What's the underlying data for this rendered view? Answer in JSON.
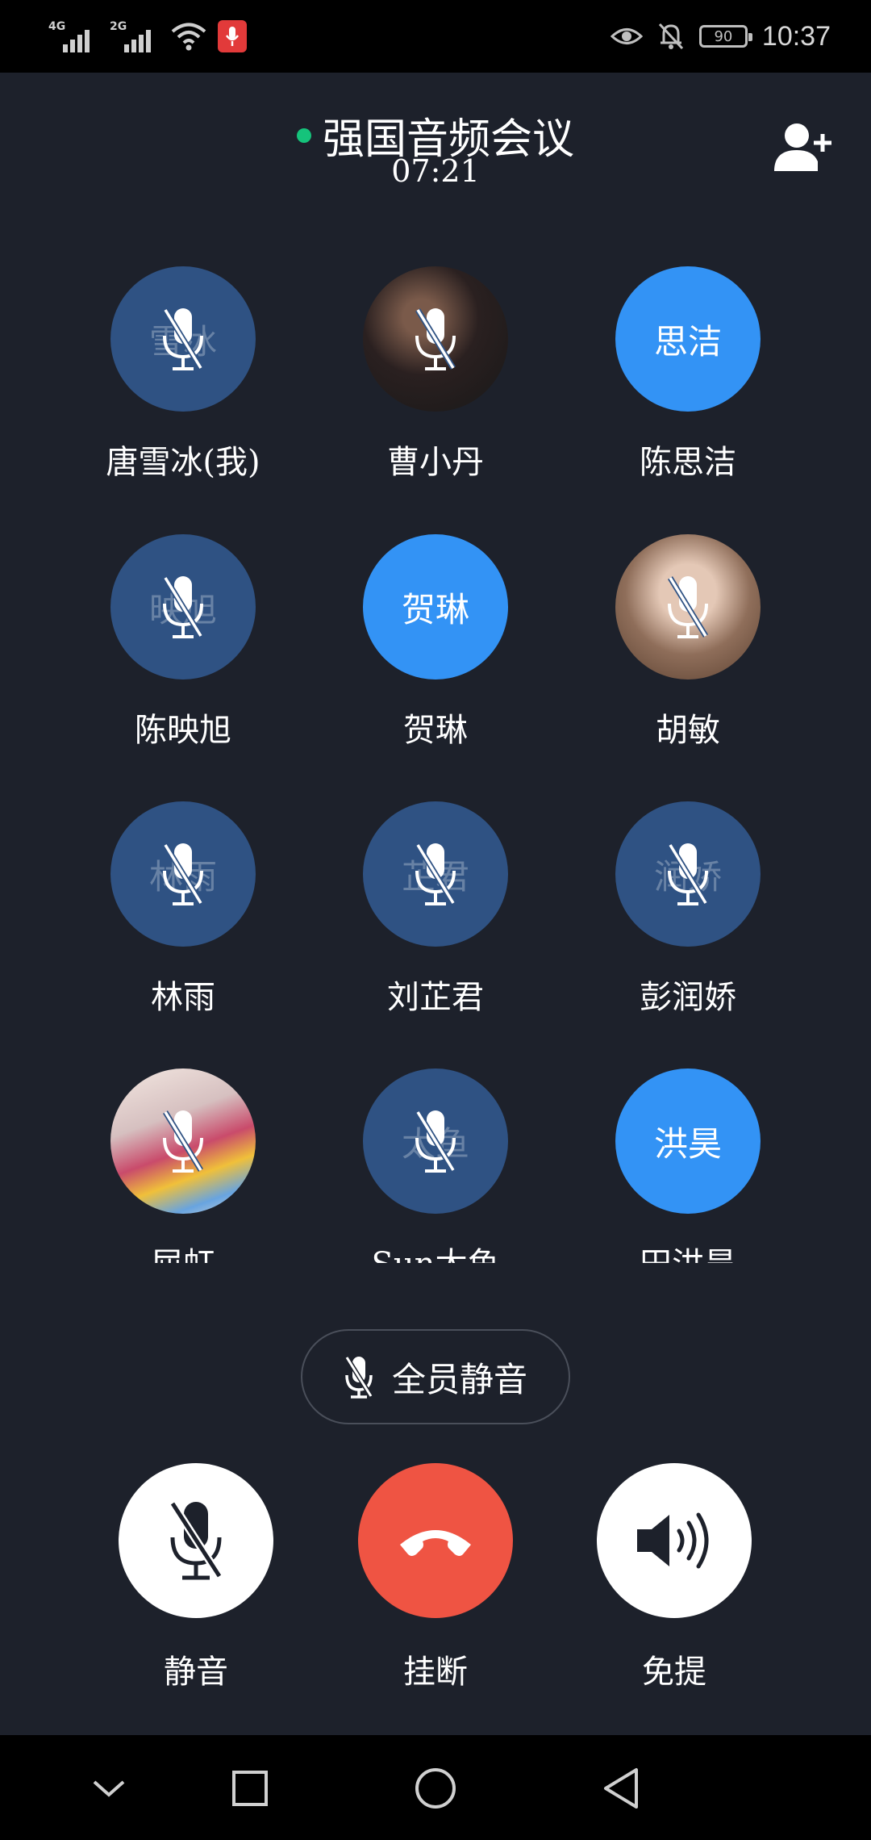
{
  "status_bar": {
    "network_1": "4G",
    "network_2": "2G",
    "battery": "90",
    "time": "10:37",
    "icons": [
      "signal-4g-icon",
      "signal-2g-icon",
      "wifi-icon",
      "recording-mic-icon",
      "eye-comfort-icon",
      "notifications-off-icon",
      "battery-icon"
    ]
  },
  "header": {
    "title": "强国音频会议",
    "timer": "07:21",
    "status_color": "#15c37b",
    "add_icon": "add-person-icon"
  },
  "participants": [
    {
      "name": "唐雪冰(我)",
      "initials": "雪冰",
      "avatar": "initials",
      "muted": true
    },
    {
      "name": "曹小丹",
      "initials": "",
      "avatar": "photo",
      "muted": true
    },
    {
      "name": "陈思洁",
      "initials": "思洁",
      "avatar": "initials",
      "muted": false
    },
    {
      "name": "陈映旭",
      "initials": "映旭",
      "avatar": "initials",
      "muted": true
    },
    {
      "name": "贺琳",
      "initials": "贺琳",
      "avatar": "initials",
      "muted": false
    },
    {
      "name": "胡敏",
      "initials": "",
      "avatar": "photo",
      "muted": true
    },
    {
      "name": "林雨",
      "initials": "林雨",
      "avatar": "initials",
      "muted": true
    },
    {
      "name": "刘芷君",
      "initials": "芷君",
      "avatar": "initials",
      "muted": true
    },
    {
      "name": "彭润娇",
      "initials": "润娇",
      "avatar": "initials",
      "muted": true
    },
    {
      "name": "屈虹",
      "initials": "",
      "avatar": "photo",
      "muted": true
    },
    {
      "name": "Sun太鱼",
      "initials": "太鱼",
      "avatar": "initials",
      "muted": true
    },
    {
      "name": "田洪昊",
      "initials": "洪昊",
      "avatar": "initials",
      "muted": false
    }
  ],
  "mute_all": {
    "label": "全员静音",
    "icon": "mic-off-icon"
  },
  "controls": {
    "mute": {
      "label": "静音",
      "icon": "mic-off-icon"
    },
    "hangup": {
      "label": "挂断",
      "icon": "phone-hangup-icon"
    },
    "speaker": {
      "label": "免提",
      "icon": "speaker-icon"
    }
  },
  "colors": {
    "background": "#1d212b",
    "avatar_muted": "#2f5283",
    "avatar_active": "#3393f5",
    "hangup": "#ef5443"
  },
  "nav_bar": {
    "icons": [
      "collapse-chevron-icon",
      "recents-square-icon",
      "home-circle-icon",
      "back-triangle-icon"
    ]
  }
}
